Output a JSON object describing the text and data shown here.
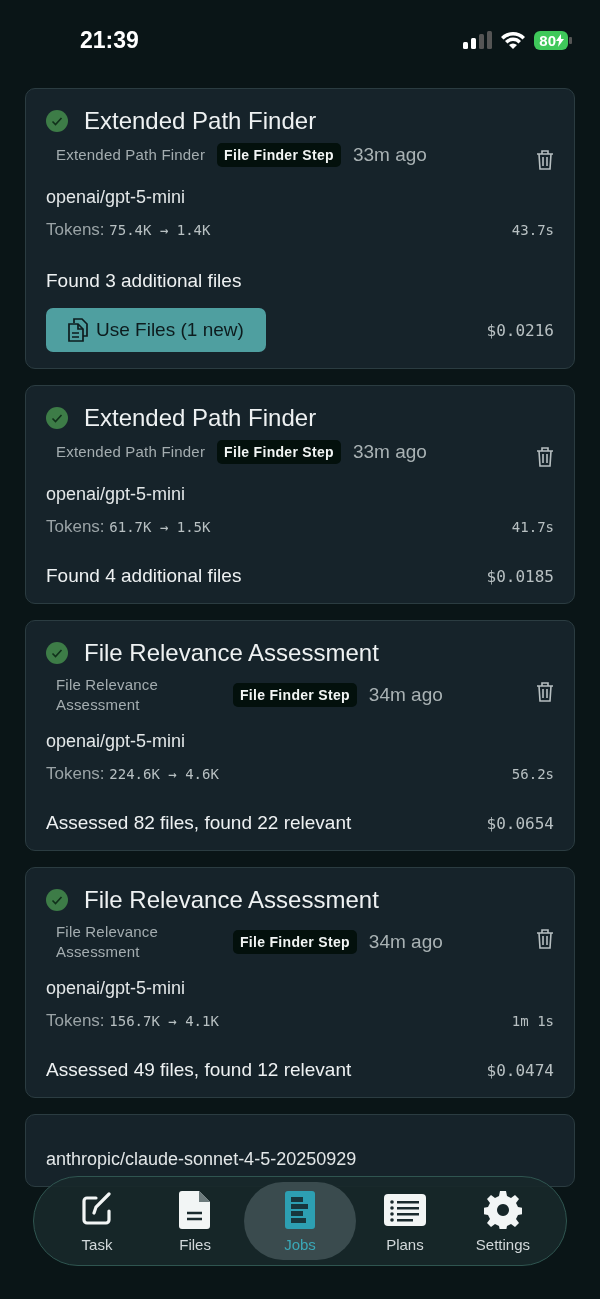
{
  "status_bar": {
    "time": "21:39",
    "battery": "80"
  },
  "jobs": [
    {
      "kind": "completed",
      "title": "Extended Path Finder",
      "subtitle": "Extended Path Finder",
      "badge": "File Finder Step",
      "time": "33m ago",
      "model": "openai/gpt-5-mini",
      "tokens_label": "Tokens:",
      "tokens": "75.4K → 1.4K",
      "duration": "43.7s",
      "result": "Found 3 additional files",
      "action": "Use Files (1 new)",
      "cost": "$0.0216"
    },
    {
      "kind": "completed",
      "title": "Extended Path Finder",
      "subtitle": "Extended Path Finder",
      "badge": "File Finder Step",
      "time": "33m ago",
      "model": "openai/gpt-5-mini",
      "tokens_label": "Tokens:",
      "tokens": "61.7K → 1.5K",
      "duration": "41.7s",
      "result": "Found 4 additional files",
      "cost": "$0.0185"
    },
    {
      "kind": "completed",
      "title": "File Relevance Assessment",
      "subtitle": "File Relevance Assessment",
      "badge": "File Finder Step",
      "time": "34m ago",
      "model": "openai/gpt-5-mini",
      "tokens_label": "Tokens:",
      "tokens": "224.6K → 4.6K",
      "duration": "56.2s",
      "result": "Assessed 82 files, found 22 relevant",
      "cost": "$0.0654"
    },
    {
      "kind": "completed",
      "title": "File Relevance Assessment",
      "subtitle": "File Relevance Assessment",
      "badge": "File Finder Step",
      "time": "34m ago",
      "model": "openai/gpt-5-mini",
      "tokens_label": "Tokens:",
      "tokens": "156.7K → 4.1K",
      "duration": "1m 1s",
      "result": "Assessed 49 files, found 12 relevant",
      "cost": "$0.0474"
    },
    {
      "model": "anthropic/claude-sonnet-4-5-20250929"
    }
  ],
  "tab_bar": [
    {
      "kind": "task",
      "label": "Task",
      "selected": false
    },
    {
      "kind": "files",
      "label": "Files",
      "selected": false
    },
    {
      "kind": "jobs",
      "label": "Jobs",
      "selected": true
    },
    {
      "kind": "plans",
      "label": "Plans",
      "selected": false
    },
    {
      "kind": "settings",
      "label": "Settings",
      "selected": false
    }
  ]
}
